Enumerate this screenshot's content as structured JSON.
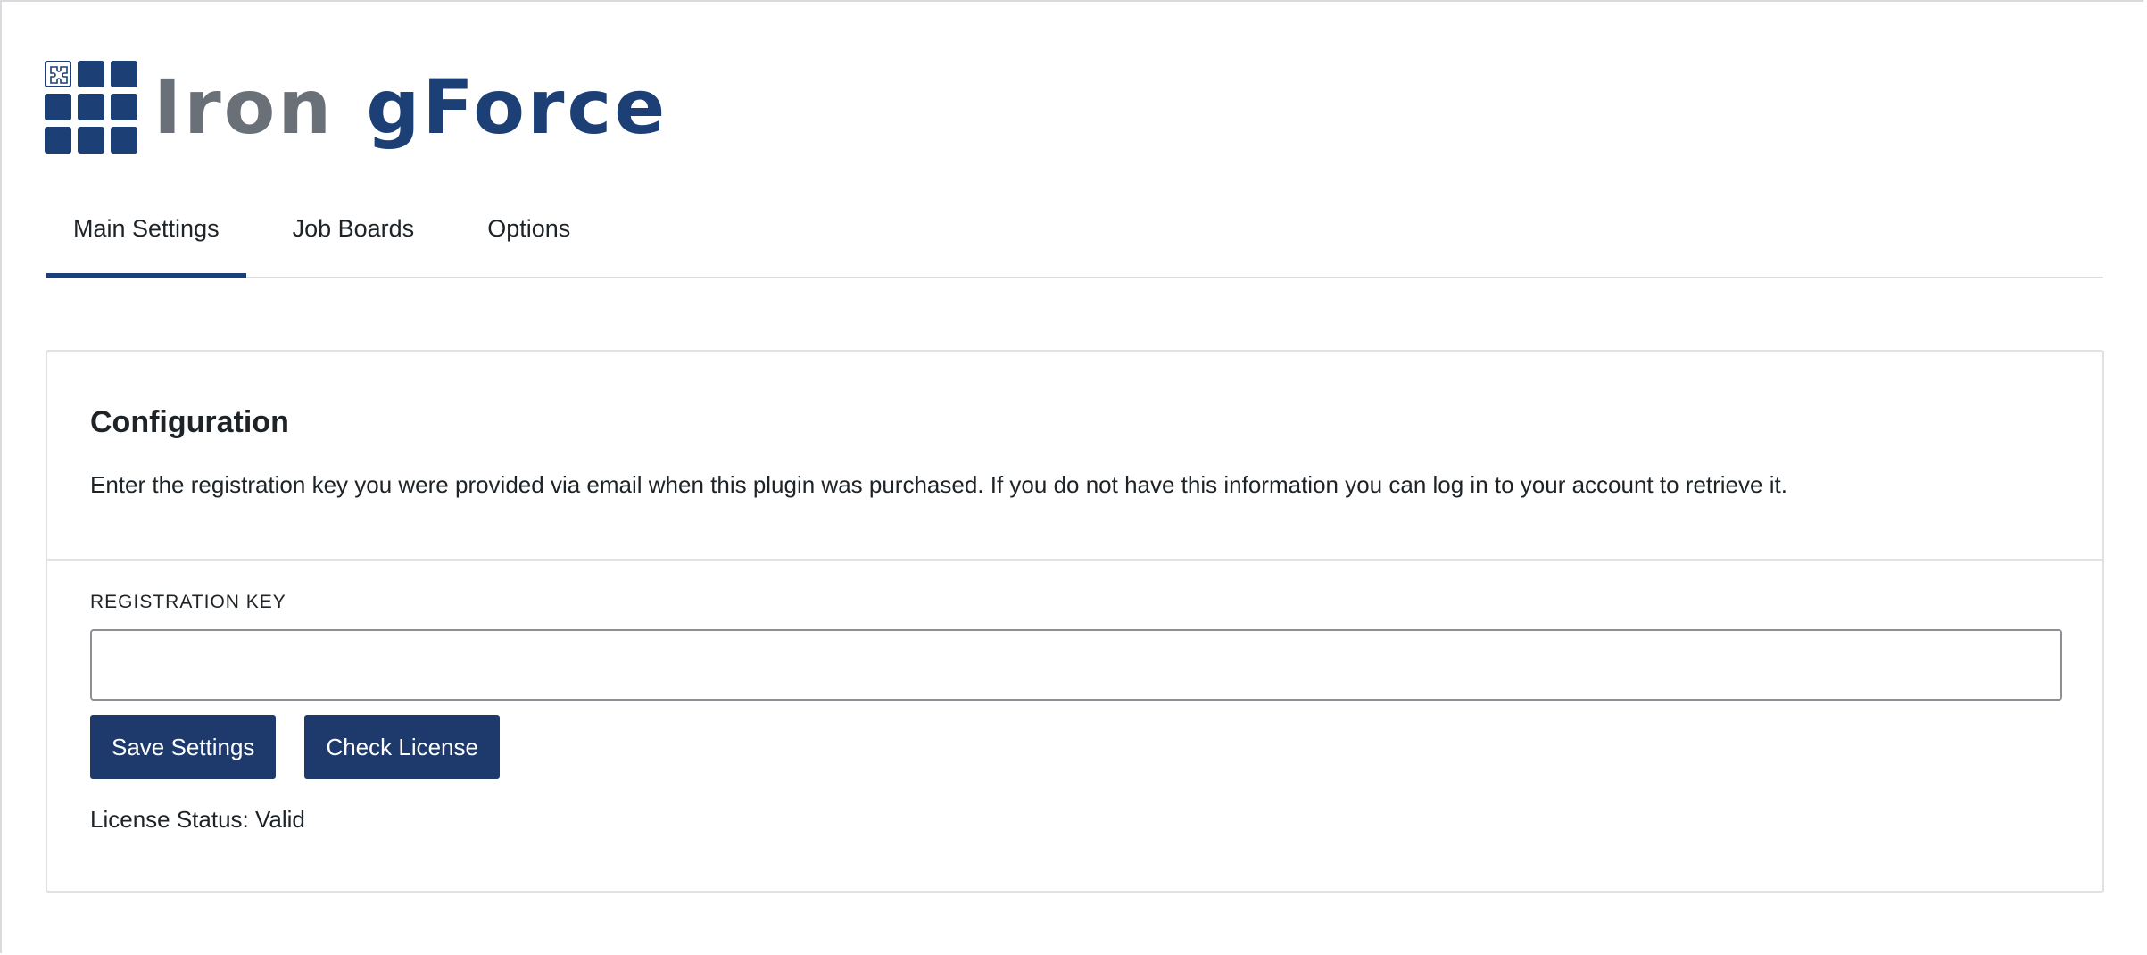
{
  "brand": {
    "word1": "Iron",
    "word2": "gForce",
    "logo_icon": "puzzle-grid-icon",
    "colors": {
      "primary": "#1c3f75",
      "secondary": "#6a7077"
    }
  },
  "tabs": [
    {
      "label": "Main Settings",
      "active": true
    },
    {
      "label": "Job Boards",
      "active": false
    },
    {
      "label": "Options",
      "active": false
    }
  ],
  "config": {
    "title": "Configuration",
    "description": "Enter the registration key you were provided via email when this plugin was purchased. If you do not have this information you can log in to your account to retrieve it.",
    "field_label": "REGISTRATION KEY",
    "key_value": "",
    "save_label": "Save Settings",
    "check_label": "Check License",
    "status_text": "License Status: Valid"
  }
}
